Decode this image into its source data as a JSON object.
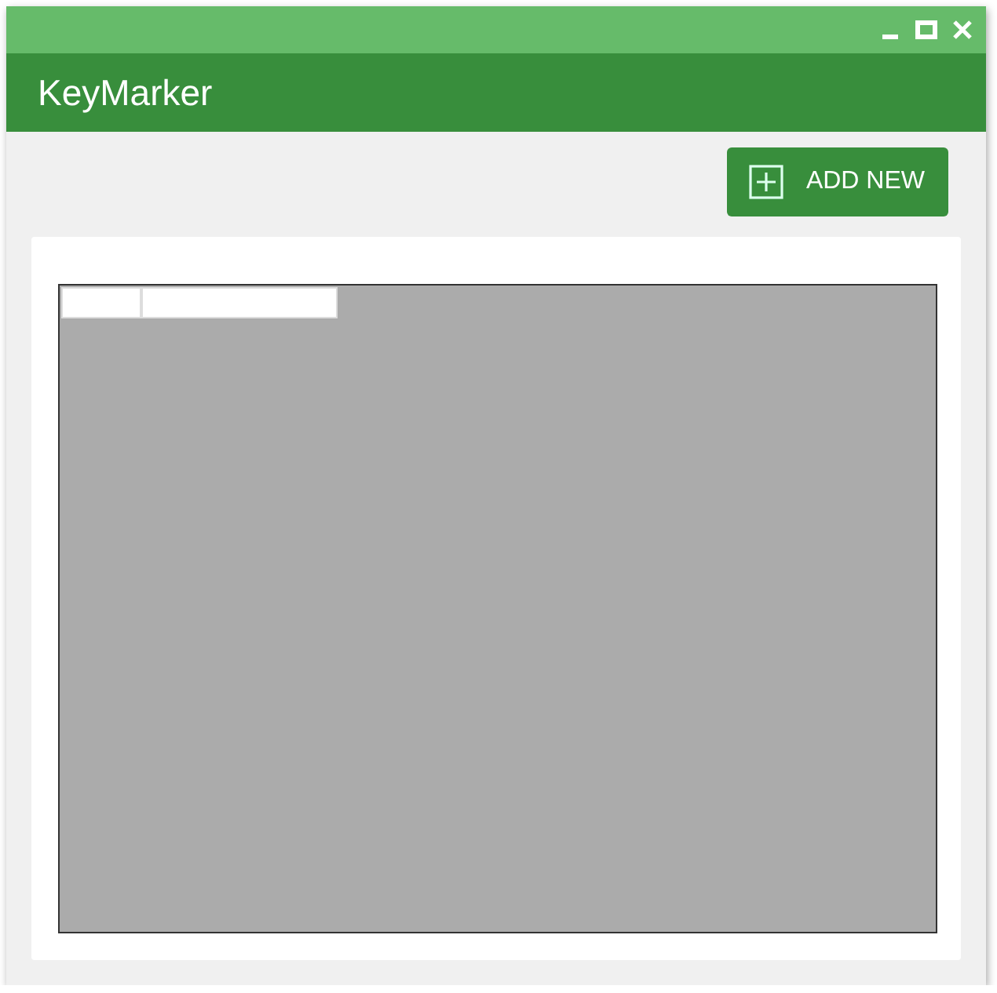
{
  "app": {
    "title": "KeyMarker"
  },
  "toolbar": {
    "buttons": [
      {
        "label": "ADD NEW"
      }
    ]
  }
}
